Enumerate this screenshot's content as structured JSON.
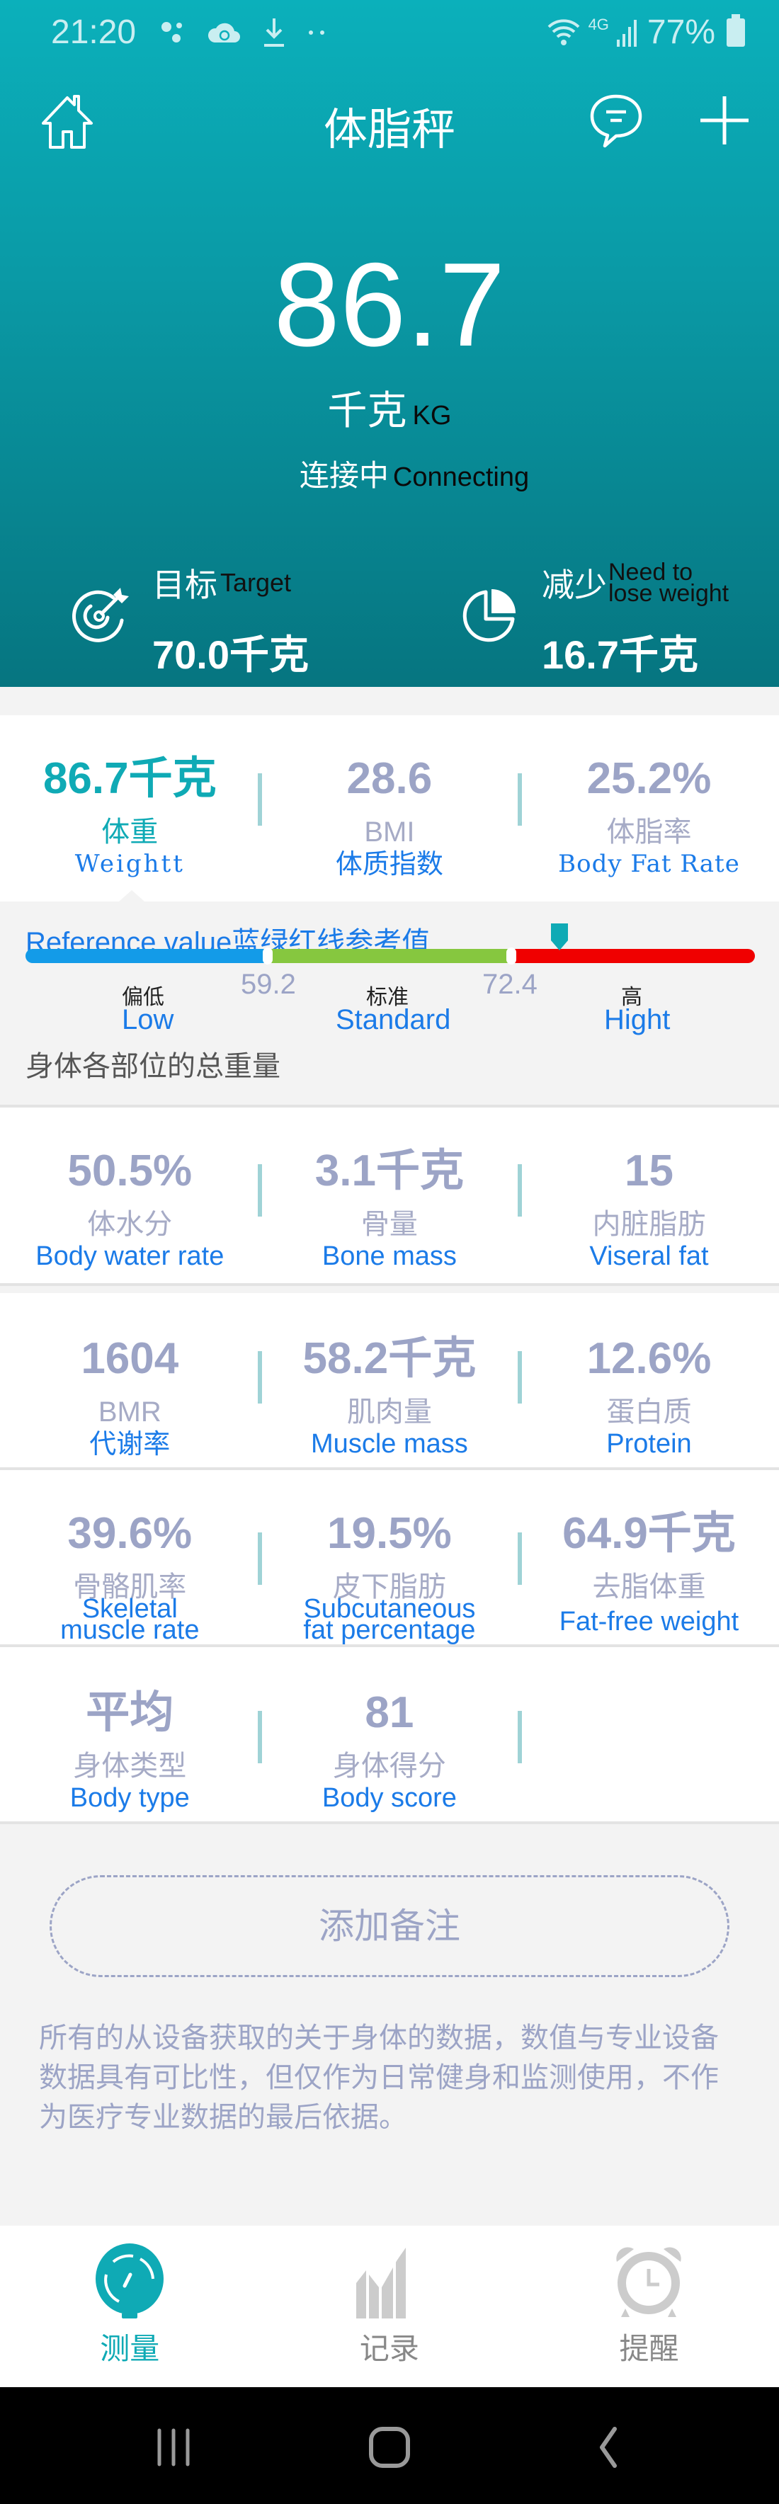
{
  "status_bar": {
    "time": "21:20",
    "network": "4G",
    "battery": "77%",
    "left_icons": [
      "assistant-dots-icon",
      "cloud-sync-icon",
      "download-icon",
      "more-dots-icon"
    ],
    "right_icons": [
      "wifi-icon",
      "signal-icon",
      "battery-icon"
    ]
  },
  "header": {
    "title": "体脂秤",
    "weight": "86.7",
    "unit_cn": "千克",
    "unit_en": "KG",
    "connection_cn": "连接中",
    "connection_en": "Connecting",
    "target": {
      "label_cn": "目标",
      "label_en": "Target",
      "value": "70.0千克"
    },
    "lose": {
      "label_cn": "减少",
      "label_en_line1": "Need to",
      "label_en_line2": "lose weight",
      "value": "16.7千克"
    },
    "accent_color": "#0bb0bb"
  },
  "metrics": {
    "row1": [
      {
        "value": "86.7千克",
        "cn": "体重",
        "en": "Weightt",
        "selected": true
      },
      {
        "value": "28.6",
        "cn": "BMI",
        "en": "体质指数"
      },
      {
        "value": "25.2%",
        "cn": "体脂率",
        "en": "Body Fat Rate"
      }
    ],
    "row2": [
      {
        "value": "50.5%",
        "cn": "体水分",
        "en": "Body water rate"
      },
      {
        "value": "3.1千克",
        "cn": "骨量",
        "en": "Bone mass"
      },
      {
        "value": "15",
        "cn": "内脏脂肪",
        "en": "Viseral fat"
      }
    ],
    "row3": [
      {
        "value": "1604",
        "cn": "BMR",
        "en": "代谢率"
      },
      {
        "value": "58.2千克",
        "cn": "肌肉量",
        "en": "Muscle mass"
      },
      {
        "value": "12.6%",
        "cn": "蛋白质",
        "en": "Protein"
      }
    ],
    "row4": [
      {
        "value": "39.6%",
        "cn": "骨骼肌率",
        "en_line1": "Skeletal",
        "en_line2": "muscle rate"
      },
      {
        "value": "19.5%",
        "cn": "皮下脂肪",
        "en_line1": "Subcutaneous",
        "en_line2": "fat percentage"
      },
      {
        "value": "64.9千克",
        "cn": "去脂体重",
        "en": "Fat-free weight"
      }
    ],
    "row5": [
      {
        "value": "平均",
        "cn": "身体类型",
        "en": "Body type"
      },
      {
        "value": "81",
        "cn": "身体得分",
        "en": "Body score"
      }
    ]
  },
  "reference": {
    "title": "Reference value蓝绿红线参考值",
    "thresholds": [
      "59.2",
      "72.4"
    ],
    "current_value": 86.7,
    "segments": [
      {
        "cn": "偏低",
        "en": "Low",
        "color": "#139be8"
      },
      {
        "cn": "标准",
        "en": "Standard",
        "color": "#86c73f"
      },
      {
        "cn": "高",
        "en": "Hight",
        "color": "#f00000"
      }
    ],
    "note": "身体各部位的总重量"
  },
  "add_note_label": "添加备注",
  "disclaimer": "所有的从设备获取的关于身体的数据，数值与专业设备数据具有可比性，但仅作为日常健身和监测使用，不作为医疗专业数据的最后依据。",
  "bottom_nav": [
    {
      "label": "测量",
      "icon": "gauge-icon",
      "active": true
    },
    {
      "label": "记录",
      "icon": "chart-icon",
      "active": false
    },
    {
      "label": "提醒",
      "icon": "alarm-clock-icon",
      "active": false
    }
  ]
}
